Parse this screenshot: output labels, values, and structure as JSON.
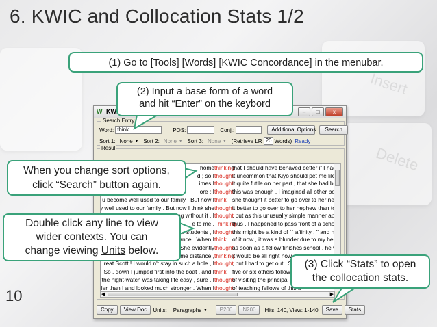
{
  "slide": {
    "title": "6. KWIC and Collocation Stats 1/2",
    "page_number": "10"
  },
  "background": {
    "key_words": [
      "Insert",
      "Delete"
    ]
  },
  "callouts": {
    "c1": "(1) Go to [Tools] [Words] [KWIC  Concordance] in the menubar.",
    "c2_line1": "(2) Input a base form of a word",
    "c2_line2": "and hit “Enter” on the keybord",
    "c3_line1": "When you change sort options,",
    "c3_line2": "click “Search” button again.",
    "c4_line1": "Double click any line to view",
    "c4_line2": "wider contexts. You can",
    "c4_line3_pre": "change viewing ",
    "c4_line3_units": "Units",
    "c4_line3_post": " below.",
    "c5_line1": "(3) Click “Stats” to open",
    "c5_line2": "the collocation stats."
  },
  "window": {
    "title": "KWI",
    "app_icon": "W",
    "controls": {
      "minimize": "–",
      "maximize": "□",
      "close": "x"
    },
    "search_entry": {
      "group_label": "Search Entry",
      "word_label": "Word:",
      "word_value": "think",
      "pos_label": "POS:",
      "pos_value": "",
      "conj_label": "Conj.:",
      "conj_value": "",
      "additional_options": "Additional Options",
      "search_button": "Search",
      "sort1_label": "Sort 1:",
      "sort1_value": "None",
      "sort2_label": "Sort 2:",
      "sort2_value": "None",
      "sort3_label": "Sort 3:",
      "sort3_value": "None",
      "retrieve_label": "(Retrieve LR",
      "retrieve_value": "20",
      "words_label": "Words)",
      "status": "Ready"
    },
    "result_label": "Resul",
    "kwic_rows": [
      {
        "left": "home",
        "kw": "thinking",
        "right": "that I should have behaved better if I had know"
      },
      {
        "left": "d ; so I",
        "kw": "thought",
        "right": "it uncommon that Kiyo should pet me like that"
      },
      {
        "left": "imes I",
        "kw": "thought",
        "right": "it quite futile on her part , that she had better c"
      },
      {
        "left": "ore ; I",
        "kw": "thought",
        "right": "this was enough . I imagined all other boys we"
      },
      {
        "left": "u become well used to our family . But now I",
        "kw": "think",
        "right": "she thought it better to go over to her nephew"
      },
      {
        "left": "y well used to our family . But now I think she",
        "kw": "thought",
        "right": "it better to go over to her nephew than to start"
      },
      {
        "left": "ing without it , I",
        "kw": "thought",
        "right": ", but as this unusually simple manner appeale"
      },
      {
        "left": "e to me .",
        "kw": "Thinking",
        "right": "thus , I happened to pass front of a school of p"
      },
      {
        "left": "e students , I",
        "kw": "thought",
        "right": "this might be a kind of `` affinity , '' and having"
      },
      {
        "left": "ance . When I",
        "kw": "think",
        "right": "of it now , it was a blunder due to my heredita"
      },
      {
        "left": ". She evidently",
        "kw": "thought",
        "right": "as soon as a fellow finishes school , he would"
      },
      {
        "left": "ome distance ,",
        "kw": "thinking",
        "right": "it would be all right now , I"
      },
      {
        "left": "reat Scott ! I would n't stay in such a hole , I",
        "kw": "thought",
        "right": ", but I had to get out . So"
      },
      {
        "left": "So , down I jumped first into the boat , and I",
        "kw": "think",
        "right": "five or six others followed"
      },
      {
        "left": "the night-watch was taking life easy , sure . I",
        "kw": "thought",
        "right": "of visiting the principal , bu"
      },
      {
        "left": "ller than I and looked much stronger . When I",
        "kw": "thought",
        "right": "of teaching fellows of this a"
      }
    ],
    "bottom": {
      "copy": "Copy",
      "view_doc": "View Doc",
      "units_label": "Units:",
      "units_value": "Paragraphs",
      "p200": "P200",
      "n200": "N200",
      "hits": "Hits: 140, View: 1-140",
      "save": "Save",
      "stats": "Stats"
    }
  },
  "colors": {
    "keyword": "#d8261c",
    "callout_border": "#3aa27a",
    "ready": "#1a3fb5"
  }
}
